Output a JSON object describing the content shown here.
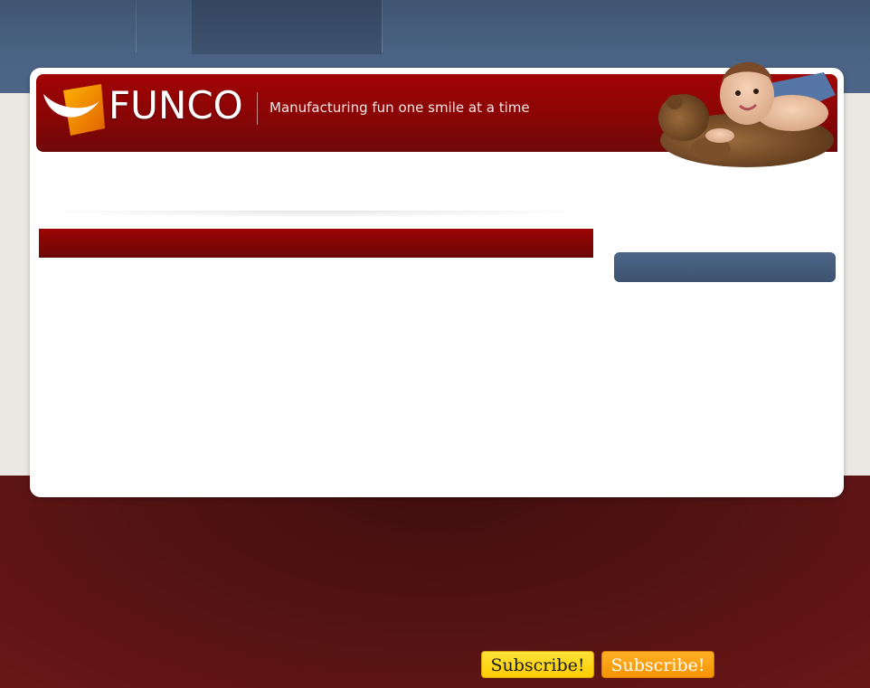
{
  "site": {
    "brand_name": "FUNCO",
    "tagline": "Manufacturing fun one smile at a time",
    "logo_icon": "smile-logo-icon"
  },
  "navigation": {
    "items": [
      {
        "label": ""
      },
      {
        "label": ""
      },
      {
        "label": "",
        "active": true
      }
    ]
  },
  "content": {
    "main_title": "",
    "sidebar_title": ""
  },
  "footer": {
    "subscribe_buttons": [
      {
        "label": "Subscribe!"
      },
      {
        "label": "Subscribe!"
      }
    ]
  },
  "colors": {
    "header_red": "#8c0505",
    "nav_blue": "#4a6283",
    "footer_maroon": "#4f1212",
    "subscribe_yellow": "#ffcc00",
    "subscribe_orange": "#f79300"
  }
}
